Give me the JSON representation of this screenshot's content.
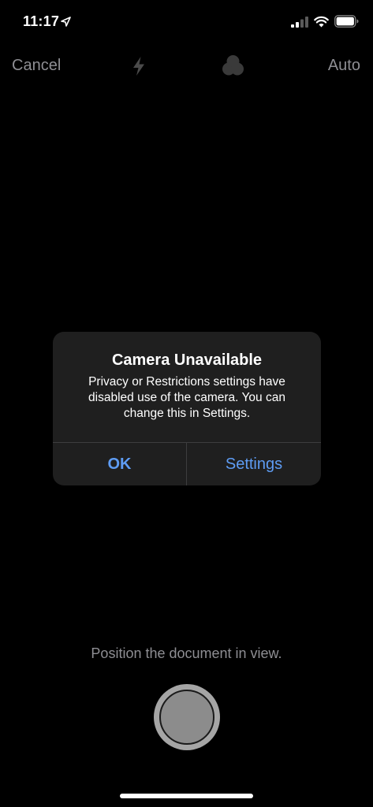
{
  "status_bar": {
    "time": "11:17",
    "icons": [
      "location-arrow-icon",
      "cellular-signal-icon",
      "wifi-icon",
      "battery-icon"
    ]
  },
  "toolbar": {
    "cancel_label": "Cancel",
    "auto_label": "Auto",
    "icons": [
      "flash-icon",
      "filter-icon"
    ]
  },
  "alert": {
    "title": "Camera Unavailable",
    "message": "Privacy or Restrictions settings have disabled use of the camera. You can change this in Settings.",
    "ok_label": "OK",
    "settings_label": "Settings"
  },
  "camera": {
    "hint": "Position the document in view."
  },
  "colors": {
    "background": "#000000",
    "alert_background": "#1f1f1f",
    "accent": "#5e9cf3",
    "secondary_text": "#8e8e93"
  }
}
